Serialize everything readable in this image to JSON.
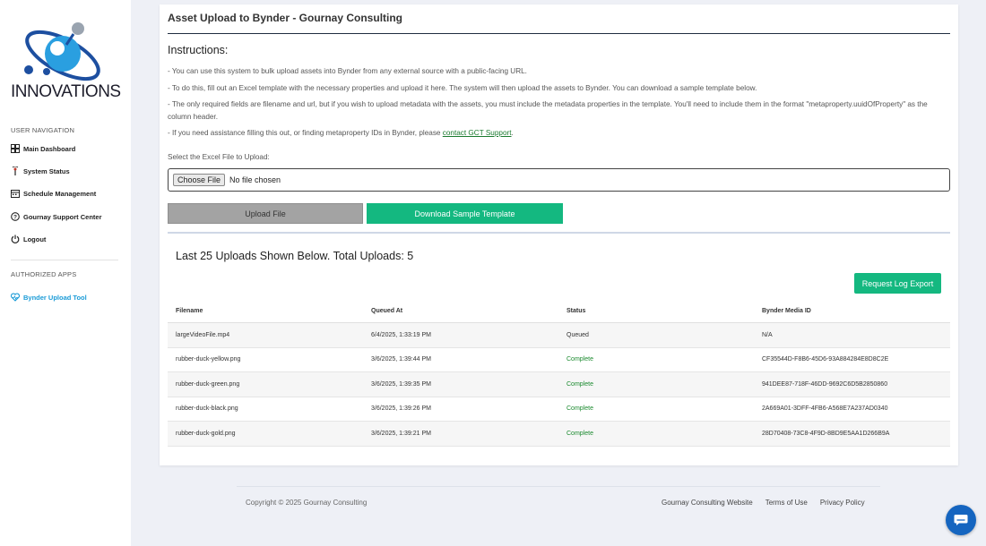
{
  "sidebar": {
    "logo_text": "INNOVATIONS",
    "user_nav_heading": "USER NAVIGATION",
    "items": [
      {
        "label": "Main Dashboard",
        "icon": "dashboard-icon"
      },
      {
        "label": "System Status",
        "icon": "status-icon"
      },
      {
        "label": "Schedule Management",
        "icon": "calendar-icon"
      },
      {
        "label": "Gournay Support Center",
        "icon": "support-icon"
      },
      {
        "label": "Logout",
        "icon": "power-icon"
      }
    ],
    "apps_heading": "AUTHORIZED APPS",
    "apps": [
      {
        "label": "Bynder Upload Tool",
        "icon": "heart-pulse-icon"
      }
    ]
  },
  "card": {
    "title": "Asset Upload to Bynder - Gournay Consulting",
    "instructions_heading": "Instructions:",
    "instructions": [
      "- You can use this system to bulk upload assets into Bynder from any external source with a public-facing URL.",
      "- To do this, fill out an Excel template with the necessary properties and upload it here. The system will then upload the assets to Bynder. You can download a sample template below.",
      "- The only required fields are filename and url, but if you wish to upload metadata with the assets, you must include the metadata properties in the template. You'll need to include them in the format \"metaproperty.uuidOfProperty\" as the column header."
    ],
    "instruction_support_prefix": "- If you need assistance filling this out, or finding metaproperty IDs in Bynder, please ",
    "instruction_support_link": "contact GCT Support",
    "instruction_support_suffix": ".",
    "file_label": "Select the Excel File to Upload:",
    "choose_file_label": "Choose File",
    "file_status": "No file chosen",
    "upload_button": "Upload File",
    "download_button": "Download Sample Template",
    "uploads_heading": "Last 25 Uploads Shown Below. Total Uploads: 5",
    "export_button": "Request Log Export"
  },
  "table": {
    "headers": [
      "Filename",
      "Queued At",
      "Status",
      "Bynder Media ID"
    ],
    "rows": [
      {
        "filename": "largeVideoFile.mp4",
        "queued": "6/4/2025, 1:33:19 PM",
        "status": "Queued",
        "media_id": "N/A"
      },
      {
        "filename": "rubber-duck-yellow.png",
        "queued": "3/6/2025, 1:39:44 PM",
        "status": "Complete",
        "media_id": "CF35544D-F8B6-45D6-93A884284E8D8C2E"
      },
      {
        "filename": "rubber-duck-green.png",
        "queued": "3/6/2025, 1:39:35 PM",
        "status": "Complete",
        "media_id": "941DEE87-718F-46DD-9692C6D5B2850860"
      },
      {
        "filename": "rubber-duck-black.png",
        "queued": "3/6/2025, 1:39:26 PM",
        "status": "Complete",
        "media_id": "2A669A01-3DFF-4FB6-A568E7A237AD0340"
      },
      {
        "filename": "rubber-duck-gold.png",
        "queued": "3/6/2025, 1:39:21 PM",
        "status": "Complete",
        "media_id": "28D70408-73C8-4F9D-8BD9E5AA1D266B9A"
      }
    ]
  },
  "footer": {
    "copyright": "Copyright © 2025 Gournay Consulting",
    "links": [
      "Gournay Consulting Website",
      "Terms of Use",
      "Privacy Policy"
    ]
  },
  "colors": {
    "accent_green": "#14b880",
    "link_blue": "#1a9bd7",
    "complete_green": "#1a8a2e",
    "chat_blue": "#1565c0"
  }
}
